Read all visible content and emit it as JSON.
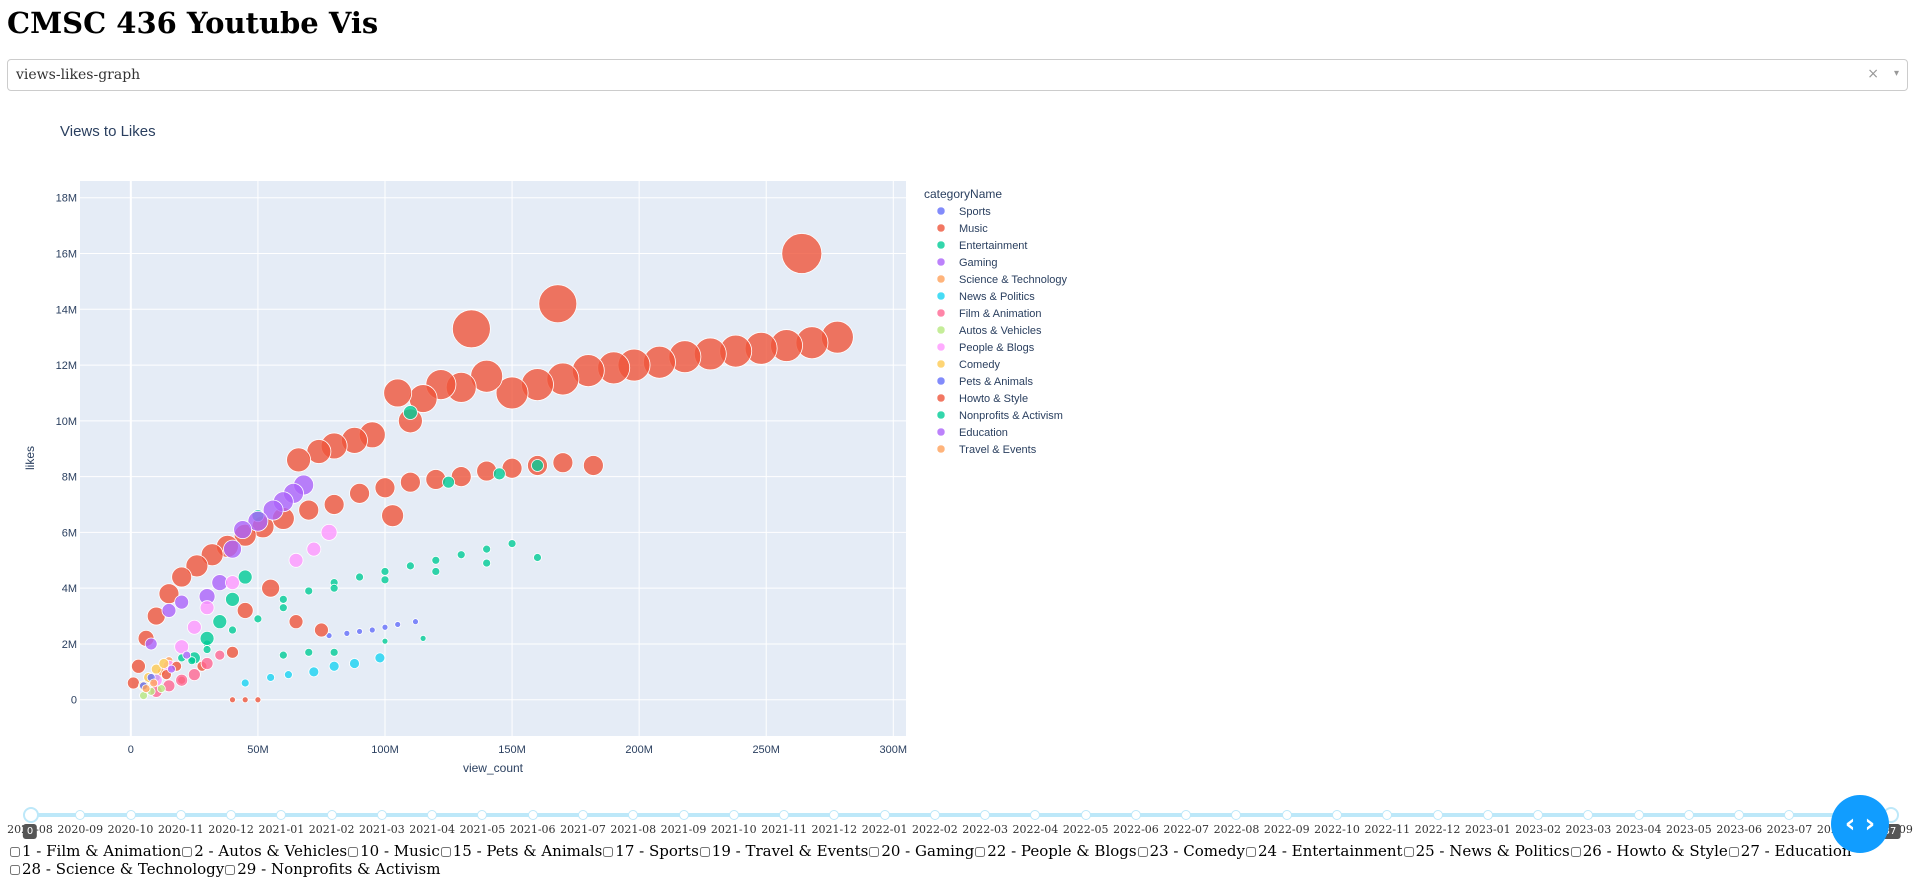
{
  "page": {
    "title": "CMSC 436 Youtube Vis"
  },
  "graph_select": {
    "value": "views-likes-graph",
    "clear_icon": "×",
    "arrow_icon": "▾"
  },
  "chart_data": {
    "type": "scatter",
    "title": "Views to Likes",
    "xlabel": "view_count",
    "ylabel": "likes",
    "xlim": [
      -20000000,
      305000000
    ],
    "ylim": [
      -1300000,
      18600000
    ],
    "x_ticks": [
      {
        "v": 0,
        "l": "0"
      },
      {
        "v": 50000000,
        "l": "50M"
      },
      {
        "v": 100000000,
        "l": "100M"
      },
      {
        "v": 150000000,
        "l": "150M"
      },
      {
        "v": 200000000,
        "l": "200M"
      },
      {
        "v": 250000000,
        "l": "250M"
      },
      {
        "v": 300000000,
        "l": "300M"
      }
    ],
    "y_ticks": [
      {
        "v": 0,
        "l": "0"
      },
      {
        "v": 2000000,
        "l": "2M"
      },
      {
        "v": 4000000,
        "l": "4M"
      },
      {
        "v": 6000000,
        "l": "6M"
      },
      {
        "v": 8000000,
        "l": "8M"
      },
      {
        "v": 10000000,
        "l": "10M"
      },
      {
        "v": 12000000,
        "l": "12M"
      },
      {
        "v": 14000000,
        "l": "14M"
      },
      {
        "v": 16000000,
        "l": "16M"
      },
      {
        "v": 18000000,
        "l": "18M"
      }
    ],
    "grid": true,
    "legend_title": "categoryName",
    "legend_placement": "right",
    "series": [
      {
        "name": "Sports",
        "color": "#636efa",
        "points": [
          [
            95000000,
            2500000,
            3
          ],
          [
            105000000,
            2700000,
            3
          ],
          [
            112000000,
            2800000,
            3
          ],
          [
            100000000,
            2600000,
            3
          ],
          [
            90000000,
            2450000,
            3
          ],
          [
            85000000,
            2380000,
            3
          ],
          [
            78000000,
            2300000,
            3
          ]
        ]
      },
      {
        "name": "Music",
        "color": "#ef553b",
        "points": [
          [
            264000000,
            16000000,
            20
          ],
          [
            168000000,
            14200000,
            19
          ],
          [
            134000000,
            13300000,
            19
          ],
          [
            278000000,
            13000000,
            16
          ],
          [
            268000000,
            12800000,
            16
          ],
          [
            258000000,
            12700000,
            16
          ],
          [
            248000000,
            12600000,
            16
          ],
          [
            238000000,
            12500000,
            16
          ],
          [
            228000000,
            12400000,
            16
          ],
          [
            218000000,
            12300000,
            16
          ],
          [
            208000000,
            12100000,
            16
          ],
          [
            198000000,
            12000000,
            16
          ],
          [
            190000000,
            11900000,
            16
          ],
          [
            180000000,
            11800000,
            16
          ],
          [
            170000000,
            11500000,
            16
          ],
          [
            160000000,
            11300000,
            16
          ],
          [
            150000000,
            11000000,
            16
          ],
          [
            140000000,
            11600000,
            16
          ],
          [
            130000000,
            11200000,
            15
          ],
          [
            122000000,
            11300000,
            15
          ],
          [
            115000000,
            10800000,
            14
          ],
          [
            105000000,
            11000000,
            14
          ],
          [
            110000000,
            10000000,
            12
          ],
          [
            95000000,
            9500000,
            13
          ],
          [
            88000000,
            9300000,
            13
          ],
          [
            80000000,
            9100000,
            13
          ],
          [
            74000000,
            8900000,
            12
          ],
          [
            66000000,
            8600000,
            12
          ],
          [
            182000000,
            8400000,
            10
          ],
          [
            170000000,
            8500000,
            10
          ],
          [
            160000000,
            8400000,
            10
          ],
          [
            150000000,
            8300000,
            10
          ],
          [
            140000000,
            8200000,
            10
          ],
          [
            130000000,
            8000000,
            10
          ],
          [
            120000000,
            7900000,
            10
          ],
          [
            110000000,
            7800000,
            10
          ],
          [
            100000000,
            7600000,
            10
          ],
          [
            90000000,
            7400000,
            10
          ],
          [
            80000000,
            7000000,
            10
          ],
          [
            70000000,
            6800000,
            10
          ],
          [
            60000000,
            6500000,
            11
          ],
          [
            52000000,
            6200000,
            11
          ],
          [
            45000000,
            5900000,
            11
          ],
          [
            38000000,
            5500000,
            11
          ],
          [
            32000000,
            5200000,
            11
          ],
          [
            26000000,
            4800000,
            11
          ],
          [
            20000000,
            4400000,
            10
          ],
          [
            15000000,
            3800000,
            10
          ],
          [
            10000000,
            3000000,
            9
          ],
          [
            6000000,
            2200000,
            8
          ],
          [
            3000000,
            1200000,
            7
          ],
          [
            1000000,
            600000,
            6
          ],
          [
            103000000,
            6600000,
            11
          ],
          [
            55000000,
            4000000,
            9
          ],
          [
            45000000,
            3200000,
            8
          ],
          [
            65000000,
            2800000,
            7
          ],
          [
            75000000,
            2500000,
            7
          ],
          [
            40000000,
            1700000,
            6
          ],
          [
            28000000,
            1200000,
            5
          ],
          [
            20000000,
            700000,
            4
          ],
          [
            50000000,
            0,
            3
          ],
          [
            45000000,
            0,
            3
          ],
          [
            40000000,
            0,
            3
          ]
        ]
      },
      {
        "name": "Entertainment",
        "color": "#00cc96",
        "points": [
          [
            150000000,
            5600000,
            4
          ],
          [
            140000000,
            5400000,
            4
          ],
          [
            130000000,
            5200000,
            4
          ],
          [
            120000000,
            5000000,
            4
          ],
          [
            110000000,
            4800000,
            4
          ],
          [
            100000000,
            4600000,
            4
          ],
          [
            90000000,
            4400000,
            4
          ],
          [
            80000000,
            4200000,
            4
          ],
          [
            70000000,
            3900000,
            4
          ],
          [
            60000000,
            3600000,
            4
          ],
          [
            160000000,
            5100000,
            4
          ],
          [
            140000000,
            4900000,
            4
          ],
          [
            120000000,
            4600000,
            4
          ],
          [
            100000000,
            4300000,
            4
          ],
          [
            80000000,
            4000000,
            4
          ],
          [
            60000000,
            3300000,
            4
          ],
          [
            50000000,
            2900000,
            4
          ],
          [
            40000000,
            2500000,
            4
          ],
          [
            30000000,
            2000000,
            4
          ],
          [
            20000000,
            1500000,
            4
          ],
          [
            10000000,
            800000,
            4
          ],
          [
            160000000,
            8400000,
            6
          ],
          [
            145000000,
            8100000,
            6
          ],
          [
            125000000,
            7800000,
            6
          ],
          [
            110000000,
            10300000,
            7
          ],
          [
            50000000,
            6600000,
            6
          ],
          [
            45000000,
            4400000,
            7
          ],
          [
            40000000,
            3600000,
            7
          ],
          [
            35000000,
            2800000,
            7
          ],
          [
            30000000,
            2200000,
            7
          ],
          [
            25000000,
            1500000,
            6
          ],
          [
            70000000,
            1700000,
            4
          ],
          [
            60000000,
            1600000,
            4
          ],
          [
            80000000,
            1700000,
            4
          ],
          [
            115000000,
            2200000,
            3
          ],
          [
            100000000,
            2100000,
            3
          ]
        ]
      },
      {
        "name": "Gaming",
        "color": "#ab63fa",
        "points": [
          [
            68000000,
            7700000,
            10
          ],
          [
            64000000,
            7400000,
            10
          ],
          [
            60000000,
            7100000,
            10
          ],
          [
            56000000,
            6800000,
            10
          ],
          [
            50000000,
            6400000,
            10
          ],
          [
            44000000,
            6100000,
            9
          ],
          [
            40000000,
            5400000,
            9
          ],
          [
            35000000,
            4200000,
            8
          ],
          [
            30000000,
            3700000,
            8
          ],
          [
            20000000,
            3500000,
            7
          ],
          [
            15000000,
            3200000,
            7
          ],
          [
            8000000,
            2000000,
            6
          ]
        ]
      },
      {
        "name": "Science & Technology",
        "color": "#ffa15a",
        "points": [
          [
            12000000,
            1000000,
            4
          ],
          [
            8000000,
            700000,
            4
          ],
          [
            15000000,
            1400000,
            4
          ]
        ]
      },
      {
        "name": "News & Politics",
        "color": "#19d3f3",
        "points": [
          [
            98000000,
            1500000,
            5
          ],
          [
            88000000,
            1300000,
            5
          ],
          [
            80000000,
            1200000,
            5
          ],
          [
            72000000,
            1000000,
            5
          ],
          [
            62000000,
            900000,
            4
          ],
          [
            55000000,
            800000,
            4
          ],
          [
            45000000,
            600000,
            4
          ]
        ]
      },
      {
        "name": "Film & Animation",
        "color": "#ff6692",
        "points": [
          [
            25000000,
            900000,
            6
          ],
          [
            20000000,
            700000,
            6
          ],
          [
            15000000,
            500000,
            6
          ],
          [
            10000000,
            300000,
            6
          ],
          [
            30000000,
            1300000,
            6
          ],
          [
            35000000,
            1600000,
            5
          ]
        ]
      },
      {
        "name": "Autos & Vehicles",
        "color": "#b6e880",
        "points": [
          [
            8000000,
            300000,
            4
          ],
          [
            12000000,
            400000,
            4
          ],
          [
            5000000,
            150000,
            4
          ]
        ]
      },
      {
        "name": "People & Blogs",
        "color": "#ff97ff",
        "points": [
          [
            78000000,
            6000000,
            8
          ],
          [
            72000000,
            5400000,
            7
          ],
          [
            65000000,
            5000000,
            7
          ],
          [
            40000000,
            4200000,
            7
          ],
          [
            30000000,
            3300000,
            7
          ],
          [
            25000000,
            2600000,
            7
          ],
          [
            20000000,
            1900000,
            7
          ],
          [
            15000000,
            1200000,
            6
          ],
          [
            10000000,
            700000,
            6
          ]
        ]
      },
      {
        "name": "Comedy",
        "color": "#fecb52",
        "points": [
          [
            10000000,
            1100000,
            5
          ],
          [
            7000000,
            800000,
            5
          ],
          [
            5000000,
            500000,
            5
          ],
          [
            13000000,
            1300000,
            5
          ]
        ]
      },
      {
        "name": "Pets & Animals",
        "color": "#636efa",
        "points": [
          [
            8000000,
            800000,
            4
          ],
          [
            5000000,
            500000,
            4
          ]
        ]
      },
      {
        "name": "Howto & Style",
        "color": "#ef553b",
        "points": [
          [
            18000000,
            1200000,
            5
          ],
          [
            14000000,
            900000,
            5
          ]
        ]
      },
      {
        "name": "Nonprofits & Activism",
        "color": "#00cc96",
        "points": [
          [
            30000000,
            1800000,
            4
          ],
          [
            24000000,
            1400000,
            4
          ]
        ]
      },
      {
        "name": "Education",
        "color": "#ab63fa",
        "points": [
          [
            22000000,
            1600000,
            4
          ],
          [
            16000000,
            1100000,
            4
          ]
        ]
      },
      {
        "name": "Travel & Events",
        "color": "#ffa15a",
        "points": [
          [
            6000000,
            400000,
            4
          ],
          [
            9000000,
            600000,
            4
          ]
        ]
      }
    ]
  },
  "date_slider": {
    "min_label": "0",
    "max_label": "37",
    "labels": [
      "2020-08",
      "2020-09",
      "2020-10",
      "2020-11",
      "2020-12",
      "2021-01",
      "2021-02",
      "2021-03",
      "2021-04",
      "2021-05",
      "2021-06",
      "2021-07",
      "2021-08",
      "2021-09",
      "2021-10",
      "2021-11",
      "2021-12",
      "2022-01",
      "2022-02",
      "2022-03",
      "2022-04",
      "2022-05",
      "2022-06",
      "2022-07",
      "2022-08",
      "2022-09",
      "2022-10",
      "2022-11",
      "2022-12",
      "2023-01",
      "2023-02",
      "2023-03",
      "2023-04",
      "2023-05",
      "2023-06",
      "2023-07",
      "2023-08",
      "2023-09"
    ]
  },
  "checklist": {
    "items": [
      {
        "label": "1 - Film & Animation",
        "checked": false
      },
      {
        "label": "2 - Autos & Vehicles",
        "checked": false
      },
      {
        "label": "10 - Music",
        "checked": false
      },
      {
        "label": "15 - Pets & Animals",
        "checked": false
      },
      {
        "label": "17 - Sports",
        "checked": false
      },
      {
        "label": "19 - Travel & Events",
        "checked": false
      },
      {
        "label": "20 - Gaming",
        "checked": false
      },
      {
        "label": "22 - People & Blogs",
        "checked": false
      },
      {
        "label": "23 - Comedy",
        "checked": false
      },
      {
        "label": "24 - Entertainment",
        "checked": false
      },
      {
        "label": "25 - News & Politics",
        "checked": false
      },
      {
        "label": "26 - Howto & Style",
        "checked": false
      },
      {
        "label": "27 - Education",
        "checked": false
      },
      {
        "label": "28 - Science & Technology",
        "checked": false
      },
      {
        "label": "29 - Nonprofits & Activism",
        "checked": false
      }
    ]
  },
  "nav_button": {
    "icon": "code-brackets-icon",
    "glyph": "‹ ›"
  }
}
